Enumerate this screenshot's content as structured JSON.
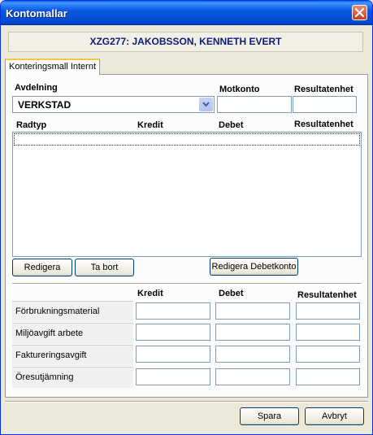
{
  "window": {
    "title": "Kontomallar"
  },
  "header": {
    "person": "XZG277: JAKOBSSON, KENNETH EVERT"
  },
  "tab": {
    "label": "Konteringsmall Internt"
  },
  "form": {
    "avdelning_label": "Avdelning",
    "avdelning_value": "VERKSTAD",
    "motkonto_label": "Motkonto",
    "motkonto_value": "",
    "resultatenhet_label": "Resultatenhet",
    "resultatenhet_value": ""
  },
  "table": {
    "columns": [
      "Radtyp",
      "Kredit",
      "Debet",
      "Resultatenhet"
    ],
    "rows": []
  },
  "buttons": {
    "redigera": "Redigera",
    "ta_bort": "Ta bort",
    "redigera_debetkonto": "Redigera Debetkonto",
    "spara": "Spara",
    "avbryt": "Avbryt"
  },
  "grid": {
    "columns": [
      "Kredit",
      "Debet",
      "Resultatenhet"
    ],
    "rows": [
      {
        "label": "Förbrukningsmaterial",
        "kredit": "",
        "debet": "",
        "resultatenhet": ""
      },
      {
        "label": "Miljöavgift arbete",
        "kredit": "",
        "debet": "",
        "resultatenhet": ""
      },
      {
        "label": "Faktureringsavgift",
        "kredit": "",
        "debet": "",
        "resultatenhet": ""
      },
      {
        "label": "Öresutjämning",
        "kredit": "",
        "debet": "",
        "resultatenhet": ""
      }
    ]
  },
  "icons": {
    "close": "close-icon",
    "dropdown": "chevron-down-icon"
  },
  "colors": {
    "titlebar": "#0348d0",
    "header_text": "#0b1d7a",
    "input_border": "#7f9db9",
    "tab_accent": "#ffc83c"
  }
}
